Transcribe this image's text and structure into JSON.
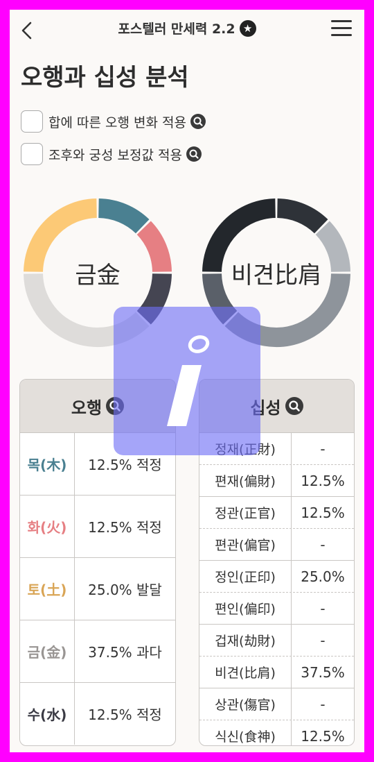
{
  "header": {
    "title": "포스텔러 만세력 2.2",
    "star_icon": "★"
  },
  "page": {
    "title": "오행과 십성 분석"
  },
  "options": [
    {
      "label": "합에 따른 오행 변화 적용",
      "checked": false
    },
    {
      "label": "조후와 궁성 보정값 적용",
      "checked": false
    }
  ],
  "donut_elements": {
    "center_label": "금金",
    "segments": [
      {
        "name": "목(木)",
        "value": 12.5,
        "color": "#4a8091"
      },
      {
        "name": "화(火)",
        "value": 12.5,
        "color": "#e67f83"
      },
      {
        "name": "수(水)",
        "value": 12.5,
        "color": "#454552"
      },
      {
        "name": "금(金)",
        "value": 37.5,
        "color": "#dedcda"
      },
      {
        "name": "토(土)",
        "value": 25.0,
        "color": "#fcc976"
      }
    ]
  },
  "donut_ten_gods": {
    "center_label": "비견比肩",
    "segments": [
      {
        "name": "식신",
        "value": 12.5,
        "color": "#2e3238"
      },
      {
        "name": "편재",
        "value": 12.5,
        "color": "#b3b7bc"
      },
      {
        "name": "비견",
        "value": 37.5,
        "color": "#8e949b"
      },
      {
        "name": "정관",
        "value": 12.5,
        "color": "#5a6069"
      },
      {
        "name": "정인",
        "value": 25.0,
        "color": "#23272c"
      }
    ]
  },
  "elements_card": {
    "header": "오행",
    "rows": [
      {
        "name": "목(木)",
        "value": "12.5% 적정",
        "color": "#4a8091"
      },
      {
        "name": "화(火)",
        "value": "12.5% 적정",
        "color": "#e67f83"
      },
      {
        "name": "토(土)",
        "value": "25.0% 발달",
        "color": "#d9a556"
      },
      {
        "name": "금(金)",
        "value": "37.5% 과다",
        "color": "#999593"
      },
      {
        "name": "수(水)",
        "value": "12.5% 적정",
        "color": "#3a3a44"
      }
    ]
  },
  "ten_gods_card": {
    "header": "십성",
    "rows": [
      {
        "name": "정재(正財)",
        "value": "-"
      },
      {
        "name": "편재(偏財)",
        "value": "12.5%"
      },
      {
        "name": "정관(正官)",
        "value": "12.5%"
      },
      {
        "name": "편관(偏官)",
        "value": "-"
      },
      {
        "name": "정인(正印)",
        "value": "25.0%"
      },
      {
        "name": "편인(偏印)",
        "value": "-"
      },
      {
        "name": "겁재(劫財)",
        "value": "-"
      },
      {
        "name": "비견(比肩)",
        "value": "37.5%"
      },
      {
        "name": "상관(傷官)",
        "value": "-"
      },
      {
        "name": "식신(食神)",
        "value": "12.5%"
      }
    ]
  },
  "overlay": {
    "icon": "info-icon"
  }
}
